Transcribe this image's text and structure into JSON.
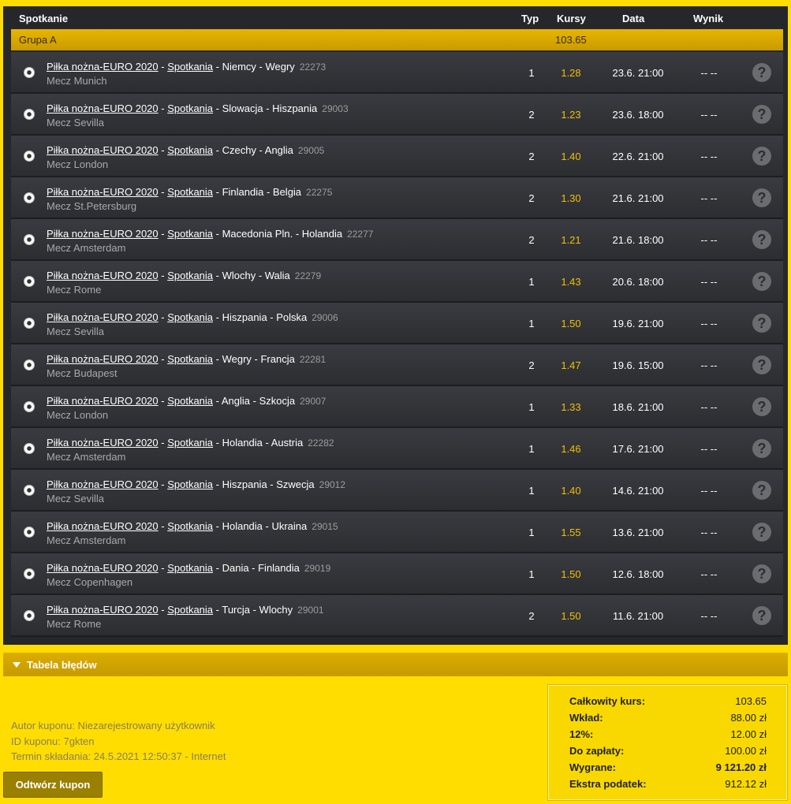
{
  "table": {
    "headers": {
      "match": "Spotkanie",
      "type": "Typ",
      "odds": "Kursy",
      "date": "Data",
      "result": "Wynik"
    },
    "group": {
      "name": "Grupa A",
      "odds": "103.65"
    },
    "rows": [
      {
        "sport": "Piłka nożna-EURO 2020",
        "category": "Spotkania",
        "teams": "Niemcy - Wegry",
        "event_id": "22273",
        "venue": "Mecz Munich",
        "type": "1",
        "odds": "1.28",
        "date": "23.6. 21:00",
        "result": "-- --"
      },
      {
        "sport": "Piłka nożna-EURO 2020",
        "category": "Spotkania",
        "teams": "Slowacja - Hiszpania",
        "event_id": "29003",
        "venue": "Mecz Sevilla",
        "type": "2",
        "odds": "1.23",
        "date": "23.6. 18:00",
        "result": "-- --"
      },
      {
        "sport": "Piłka nożna-EURO 2020",
        "category": "Spotkania",
        "teams": "Czechy - Anglia",
        "event_id": "29005",
        "venue": "Mecz London",
        "type": "2",
        "odds": "1.40",
        "date": "22.6. 21:00",
        "result": "-- --"
      },
      {
        "sport": "Piłka nożna-EURO 2020",
        "category": "Spotkania",
        "teams": "Finlandia - Belgia",
        "event_id": "22275",
        "venue": "Mecz St.Petersburg",
        "type": "2",
        "odds": "1.30",
        "date": "21.6. 21:00",
        "result": "-- --"
      },
      {
        "sport": "Piłka nożna-EURO 2020",
        "category": "Spotkania",
        "teams": "Macedonia Pln. - Holandia",
        "event_id": "22277",
        "venue": "Mecz Amsterdam",
        "type": "2",
        "odds": "1.21",
        "date": "21.6. 18:00",
        "result": "-- --"
      },
      {
        "sport": "Piłka nożna-EURO 2020",
        "category": "Spotkania",
        "teams": "Wlochy - Walia",
        "event_id": "22279",
        "venue": "Mecz Rome",
        "type": "1",
        "odds": "1.43",
        "date": "20.6. 18:00",
        "result": "-- --"
      },
      {
        "sport": "Piłka nożna-EURO 2020",
        "category": "Spotkania",
        "teams": "Hiszpania - Polska",
        "event_id": "29006",
        "venue": "Mecz Sevilla",
        "type": "1",
        "odds": "1.50",
        "date": "19.6. 21:00",
        "result": "-- --"
      },
      {
        "sport": "Piłka nożna-EURO 2020",
        "category": "Spotkania",
        "teams": "Wegry - Francja",
        "event_id": "22281",
        "venue": "Mecz Budapest",
        "type": "2",
        "odds": "1.47",
        "date": "19.6. 15:00",
        "result": "-- --"
      },
      {
        "sport": "Piłka nożna-EURO 2020",
        "category": "Spotkania",
        "teams": "Anglia - Szkocja",
        "event_id": "29007",
        "venue": "Mecz London",
        "type": "1",
        "odds": "1.33",
        "date": "18.6. 21:00",
        "result": "-- --"
      },
      {
        "sport": "Piłka nożna-EURO 2020",
        "category": "Spotkania",
        "teams": "Holandia - Austria",
        "event_id": "22282",
        "venue": "Mecz Amsterdam",
        "type": "1",
        "odds": "1.46",
        "date": "17.6. 21:00",
        "result": "-- --"
      },
      {
        "sport": "Piłka nożna-EURO 2020",
        "category": "Spotkania",
        "teams": "Hiszpania - Szwecja",
        "event_id": "29012",
        "venue": "Mecz Sevilla",
        "type": "1",
        "odds": "1.40",
        "date": "14.6. 21:00",
        "result": "-- --"
      },
      {
        "sport": "Piłka nożna-EURO 2020",
        "category": "Spotkania",
        "teams": "Holandia - Ukraina",
        "event_id": "29015",
        "venue": "Mecz Amsterdam",
        "type": "1",
        "odds": "1.55",
        "date": "13.6. 21:00",
        "result": "-- --"
      },
      {
        "sport": "Piłka nożna-EURO 2020",
        "category": "Spotkania",
        "teams": "Dania - Finlandia",
        "event_id": "29019",
        "venue": "Mecz Copenhagen",
        "type": "1",
        "odds": "1.50",
        "date": "12.6. 18:00",
        "result": "-- --"
      },
      {
        "sport": "Piłka nożna-EURO 2020",
        "category": "Spotkania",
        "teams": "Turcja - Wlochy",
        "event_id": "29001",
        "venue": "Mecz Rome",
        "type": "2",
        "odds": "1.50",
        "date": "11.6. 21:00",
        "result": "-- --"
      }
    ]
  },
  "error_table": {
    "label": "Tabela błędów"
  },
  "coupon": {
    "author": "Autor kuponu: Niezarejestrowany użytkownik",
    "id": "ID kuponu: 7gkten",
    "submitted": "Termin składania: 24.5.2021 12:50:37 - Internet",
    "restore_button": "Odtwórz kupon"
  },
  "summary": [
    {
      "label": "Całkowity kurs:",
      "value": "103.65",
      "bold": false
    },
    {
      "label": "Wkład:",
      "value": "88.00 zł",
      "bold": false
    },
    {
      "label": "12%:",
      "value": "12.00 zł",
      "bold": false
    },
    {
      "label": "Do zapłaty:",
      "value": "100.00 zł",
      "bold": false
    },
    {
      "label": "Wygrane:",
      "value": "9 121.20 zł",
      "bold": true
    },
    {
      "label": "Ekstra podatek:",
      "value": "912.12 zł",
      "bold": false
    }
  ],
  "colors": {
    "accent": "#ffdd00",
    "odds": "#f0c000",
    "panel": "#26272b"
  },
  "icons": {
    "sport": "soccer-ball-icon",
    "info": "question-mark-icon",
    "toggle": "triangle-down-icon"
  }
}
